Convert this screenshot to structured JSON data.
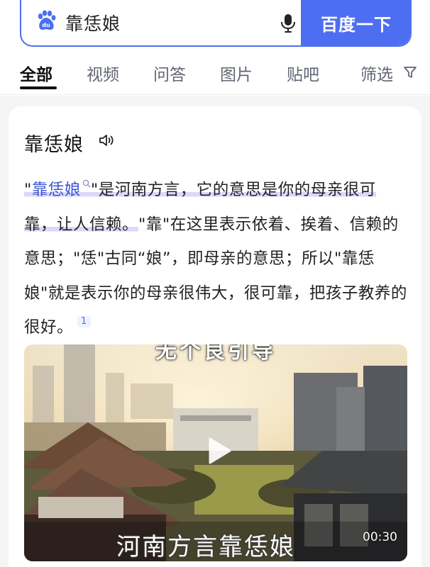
{
  "search": {
    "logo_text": "du",
    "query": "靠恁娘",
    "submit_label": "百度一下"
  },
  "tabs": [
    {
      "label": "全部",
      "active": true
    },
    {
      "label": "视频",
      "active": false
    },
    {
      "label": "问答",
      "active": false
    },
    {
      "label": "图片",
      "active": false
    },
    {
      "label": "贴吧",
      "active": false
    }
  ],
  "filter_label": "筛选",
  "card": {
    "title": "靠恁娘",
    "answer": {
      "quote_open": "\"",
      "term": "靠恁娘",
      "part1": "\"是河南方言，它的意思是你的母亲很可靠，让人信赖。",
      "part2": "\"靠\"在这里表示依着、挨着、信赖的意思；\"恁\"古同“娘”，即母亲的意思；所以\"靠恁娘\"就是表示你的母亲很伟大，很可靠，把孩子教养的很好。",
      "citation": "1"
    },
    "video": {
      "top_caption": "无个良引导",
      "caption": "河南方言靠恁娘",
      "duration": "00:30"
    }
  },
  "colors": {
    "brand_blue": "#4e6ef2",
    "highlight": "#dcd7fb",
    "link": "#3a56d4"
  },
  "icons": [
    "baidu-paw-logo-icon",
    "mic-icon",
    "caret-down-icon",
    "funnel-filter-icon",
    "speaker-icon",
    "search-q-icon",
    "play-icon"
  ]
}
